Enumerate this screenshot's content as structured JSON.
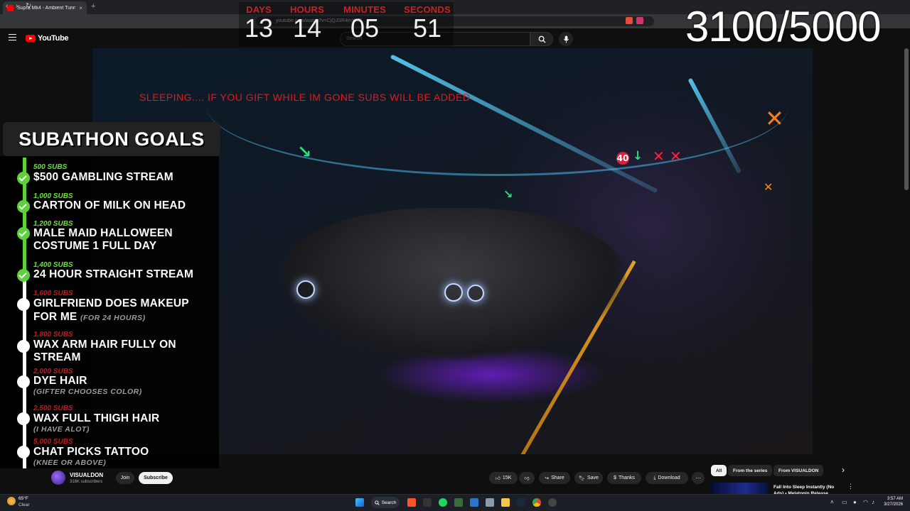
{
  "browser": {
    "tab_title": "Supra Mk4 - Ambient Tunnel",
    "close_glyph": "×",
    "new_tab_glyph": "+",
    "url": "youtube.com/watch?v=CjQJSR4mYXE"
  },
  "youtube": {
    "logo_text": "YouTube",
    "search_placeholder": "Search"
  },
  "countdown": {
    "days_label": "DAYS",
    "days_value": "13",
    "hours_label": "HOURS",
    "hours_value": "14",
    "minutes_label": "MINUTES",
    "minutes_value": "05",
    "seconds_label": "SECONDS",
    "seconds_value": "51"
  },
  "sub_counter": "3100/5000",
  "sleep_banner": "SLEEPING....  IF YOU GIFT WHILE IM GONE SUBS WILL BE ADDED",
  "goals": {
    "title": "SUBATHON GOALS",
    "items": [
      {
        "subs": "500 SUBS",
        "text": "$500 GAMBLING STREAM",
        "done": true
      },
      {
        "subs": "1,000 SUBS",
        "text": "CARTON OF MILK ON HEAD",
        "done": true
      },
      {
        "subs": "1,200 SUBS",
        "text": "MALE MAID HALLOWEEN",
        "text2": "COSTUME 1 FULL DAY",
        "done": true
      },
      {
        "subs": "1,400 SUBS",
        "text": "24 HOUR STRAIGHT STREAM",
        "done": true
      },
      {
        "subs": "1,600 SUBS",
        "text": "GIRLFRIEND DOES MAKEUP",
        "text2": "FOR ME",
        "note": "(FOR 24 HOURS)",
        "done": false
      },
      {
        "subs": "1,800 SUBS",
        "text": "WAX ARM HAIR FULLY ON",
        "text2": "STREAM",
        "done": false
      },
      {
        "subs": "2,000 SUBS",
        "text": "DYE HAIR",
        "note": "(GIFTER CHOOSES COLOR)",
        "done": false
      },
      {
        "subs": "2,500 SUBS",
        "text": "WAX FULL THIGH HAIR",
        "note": "(I HAVE ALOT)",
        "done": false
      },
      {
        "subs": "5,000 SUBS",
        "text": "CHAT PICKS TATTOO",
        "note": "(KNEE OR ABOVE)",
        "done": false
      }
    ]
  },
  "channel": {
    "name": "VISUALDON",
    "subscribers": "316K subscribers",
    "join_label": "Join",
    "subscribe_label": "Subscribe"
  },
  "actions": {
    "likes": "15K",
    "share": "Share",
    "save": "Save",
    "thanks": "Thanks",
    "download": "Download",
    "more": "⋯"
  },
  "recommendations": {
    "chips": [
      "All",
      "From the series",
      "From VISUALDON"
    ],
    "first_title": "Fall Into Sleep Instantly (No Ads) • Melatonin Release"
  },
  "taskbar": {
    "weather_temp": "65°F",
    "weather_desc": "Clear",
    "search_label": "Search",
    "time": "3:57 AM",
    "date": "3/27/2026"
  },
  "colors": {
    "countdown_label": "#d11f1f",
    "goal_done_green": "#5ed039",
    "goal_pending_red": "#c21a1a",
    "youtube_red": "#ff0000"
  }
}
